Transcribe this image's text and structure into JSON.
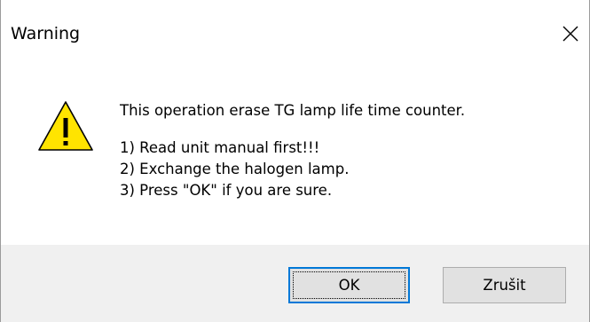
{
  "window": {
    "title": "Warning",
    "close_label": "×"
  },
  "message": {
    "headline": "This operation erase TG lamp life time counter.",
    "lines": [
      "1) Read unit manual first!!!",
      "2) Exchange the halogen lamp.",
      "3) Press \"OK\" if you are sure."
    ]
  },
  "buttons": {
    "ok_label": "OK",
    "cancel_label": "Zrušit"
  },
  "icon": {
    "name": "warning-icon",
    "fill": "#FFE400",
    "stroke": "#000000"
  },
  "colors": {
    "footer_bg": "#f0f0f0",
    "button_bg": "#e1e1e1",
    "focus_border": "#0078d7"
  }
}
